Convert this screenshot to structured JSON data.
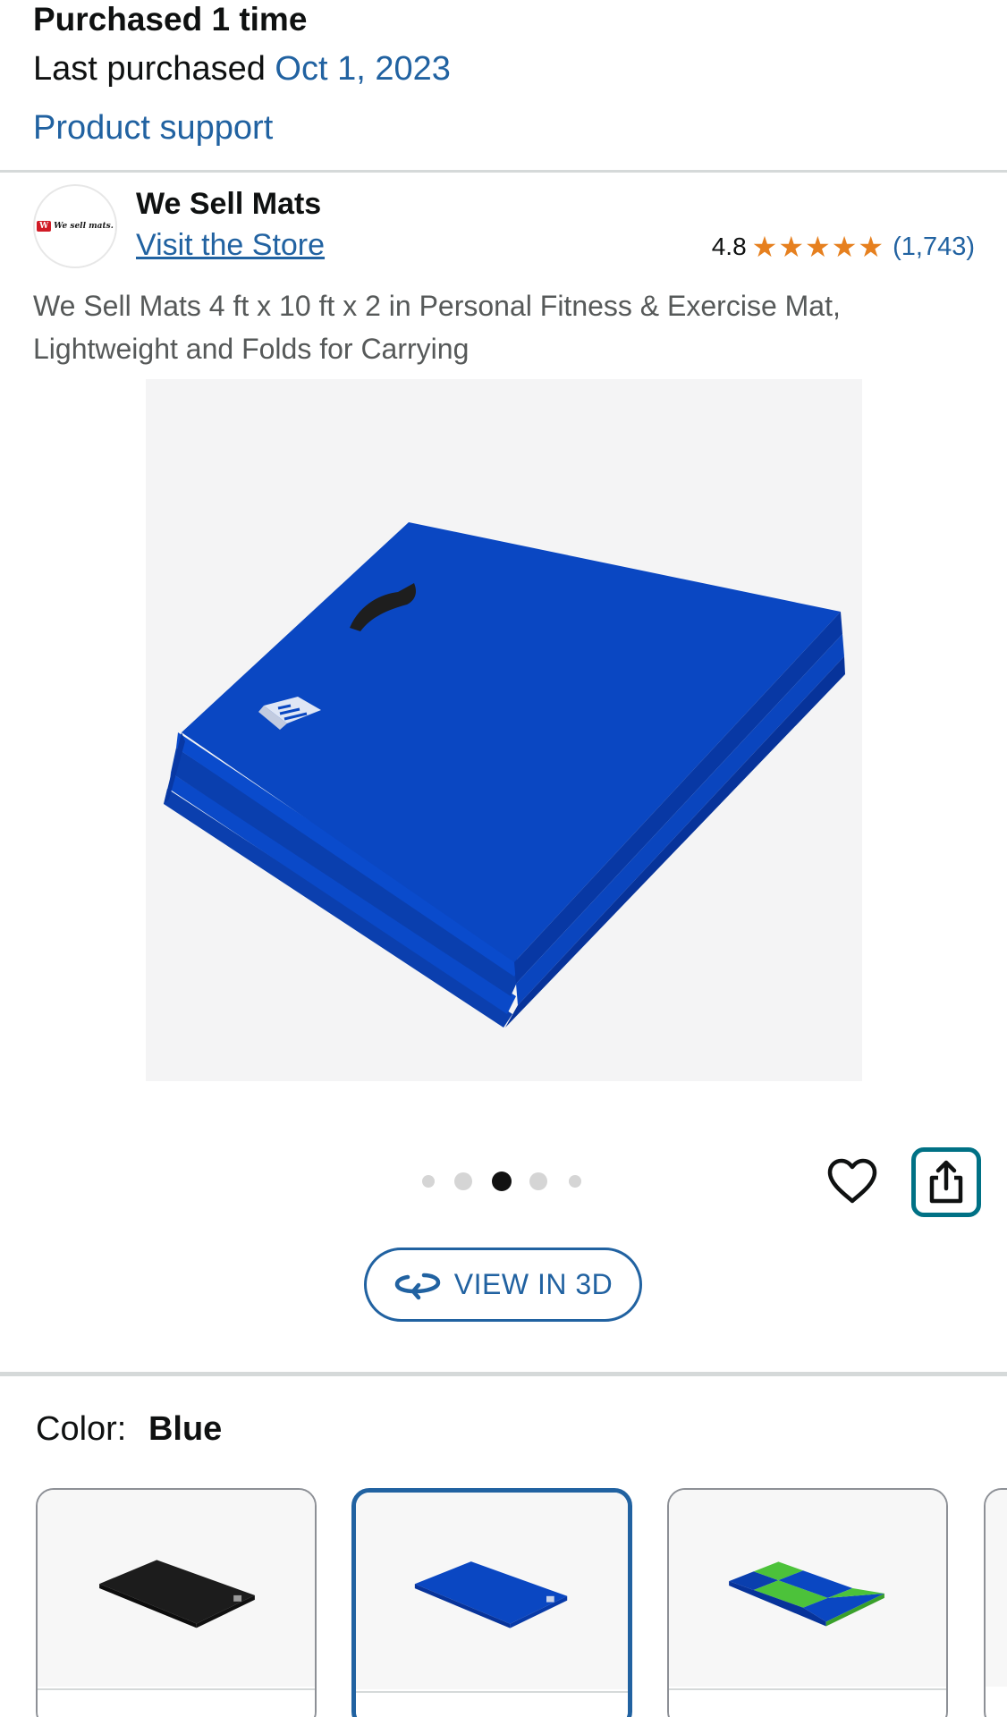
{
  "purchase": {
    "count_text": "Purchased 1 time",
    "last_purchased_label": "Last purchased",
    "last_purchased_date": "Oct 1, 2023",
    "support_link": "Product support"
  },
  "store": {
    "name": "We Sell Mats",
    "visit_link": "Visit the Store",
    "logo_text": "We sell mats.",
    "rating_value": "4.8",
    "rating_stars": 5,
    "rating_count": "(1,743)"
  },
  "product": {
    "title": "We Sell Mats 4 ft x 10 ft x 2 in Personal Fitness & Exercise Mat, Lightweight and Folds for Carrying",
    "image_icon": "blue-folded-mat-image",
    "carousel": {
      "total": 5,
      "active_index": 2
    }
  },
  "actions": {
    "wishlist_icon": "heart-icon",
    "share_icon": "share-icon",
    "view_3d_label": "VIEW IN 3D",
    "view_3d_icon": "rotate-3d-icon"
  },
  "color": {
    "label": "Color:",
    "value": "Blue",
    "options": [
      {
        "name": "Black",
        "selected": false
      },
      {
        "name": "Blue",
        "selected": true
      },
      {
        "name": "Blue/Green",
        "selected": false
      }
    ]
  },
  "colors": {
    "link": "#2162a1",
    "star": "#e6801f",
    "share_border": "#007185",
    "mat_blue": "#0a47c2",
    "mat_green": "#4cc23a",
    "mat_black": "#1c1c1c"
  }
}
